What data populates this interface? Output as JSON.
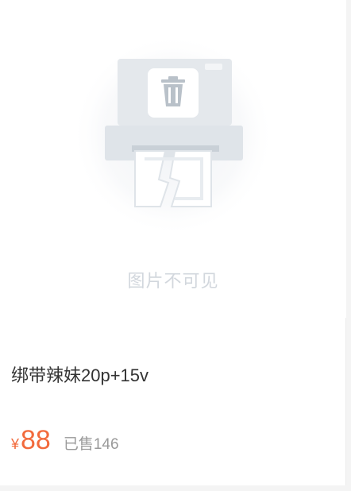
{
  "image": {
    "placeholder_text": "图片不可见",
    "icon": "broken-printer-trash-icon"
  },
  "product": {
    "title": "绑带辣妹20p+15v",
    "currency_symbol": "¥",
    "price": "88",
    "sold_text": "已售146"
  },
  "colors": {
    "accent": "#f26a3c",
    "muted_text": "#999999",
    "placeholder_text": "#d2d7dd",
    "title_text": "#333333"
  }
}
